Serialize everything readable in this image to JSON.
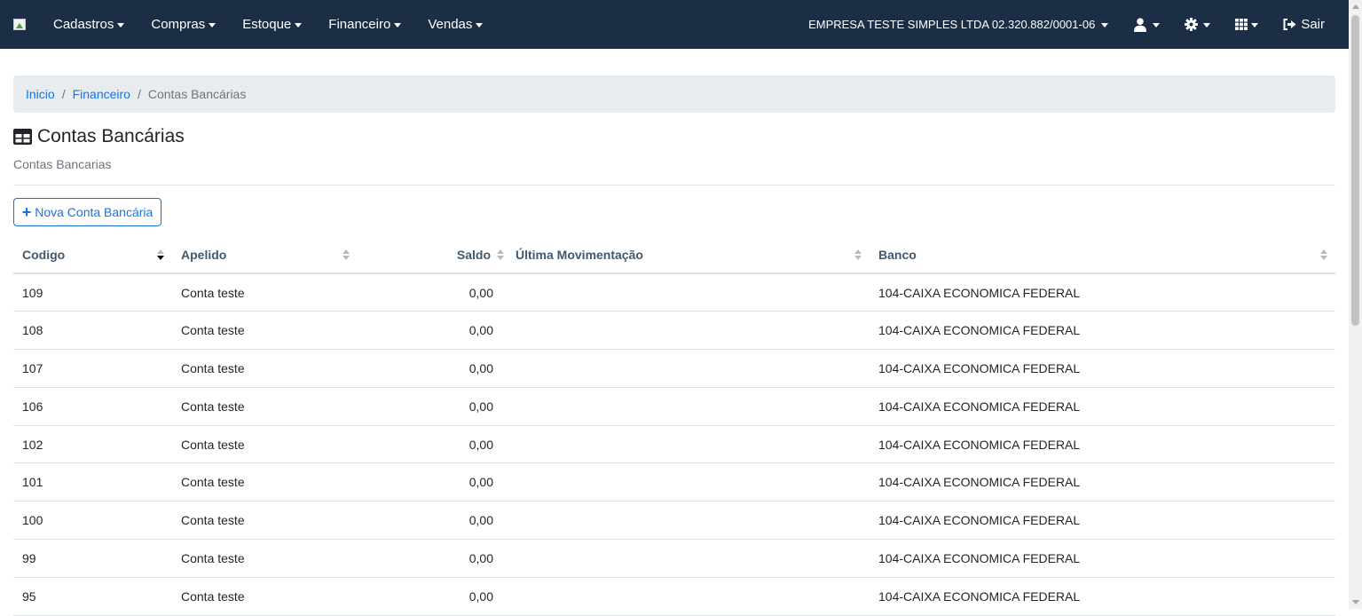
{
  "navbar": {
    "menus": [
      {
        "label": "Cadastros"
      },
      {
        "label": "Compras"
      },
      {
        "label": "Estoque"
      },
      {
        "label": "Financeiro"
      },
      {
        "label": "Vendas"
      }
    ],
    "company": "EMPRESA TESTE SIMPLES LTDA 02.320.882/0001-06",
    "logout_label": "Sair",
    "icons": [
      "user-icon",
      "gear-icon",
      "grid-icon",
      "sign-out-icon"
    ],
    "background_color": "#1b2e45"
  },
  "breadcrumb": {
    "items": [
      {
        "label": "Inicio"
      },
      {
        "label": "Financeiro"
      },
      {
        "label": "Contas Bancárias"
      }
    ]
  },
  "page": {
    "title": "Contas Bancárias",
    "subtitle": "Contas Bancarias",
    "new_button_label": "Nova Conta Bancária",
    "accent_color": "#1a73d9"
  },
  "table": {
    "columns": [
      "Codigo",
      "Apelido",
      "Saldo",
      "Última Movimentação",
      "Banco"
    ],
    "sorted_column": "Codigo",
    "sort_direction": "descending",
    "rows": [
      {
        "codigo": "109",
        "apelido": "Conta teste",
        "saldo": "0,00",
        "ultima": "",
        "banco": "104-CAIXA ECONOMICA FEDERAL"
      },
      {
        "codigo": "108",
        "apelido": "Conta teste",
        "saldo": "0,00",
        "ultima": "",
        "banco": "104-CAIXA ECONOMICA FEDERAL"
      },
      {
        "codigo": "107",
        "apelido": "Conta teste",
        "saldo": "0,00",
        "ultima": "",
        "banco": "104-CAIXA ECONOMICA FEDERAL"
      },
      {
        "codigo": "106",
        "apelido": "Conta teste",
        "saldo": "0,00",
        "ultima": "",
        "banco": "104-CAIXA ECONOMICA FEDERAL"
      },
      {
        "codigo": "102",
        "apelido": "Conta teste",
        "saldo": "0,00",
        "ultima": "",
        "banco": "104-CAIXA ECONOMICA FEDERAL"
      },
      {
        "codigo": "101",
        "apelido": "Conta teste",
        "saldo": "0,00",
        "ultima": "",
        "banco": "104-CAIXA ECONOMICA FEDERAL"
      },
      {
        "codigo": "100",
        "apelido": "Conta teste",
        "saldo": "0,00",
        "ultima": "",
        "banco": "104-CAIXA ECONOMICA FEDERAL"
      },
      {
        "codigo": "99",
        "apelido": "Conta teste",
        "saldo": "0,00",
        "ultima": "",
        "banco": "104-CAIXA ECONOMICA FEDERAL"
      },
      {
        "codigo": "95",
        "apelido": "Conta teste",
        "saldo": "0,00",
        "ultima": "",
        "banco": "104-CAIXA ECONOMICA FEDERAL"
      }
    ]
  }
}
